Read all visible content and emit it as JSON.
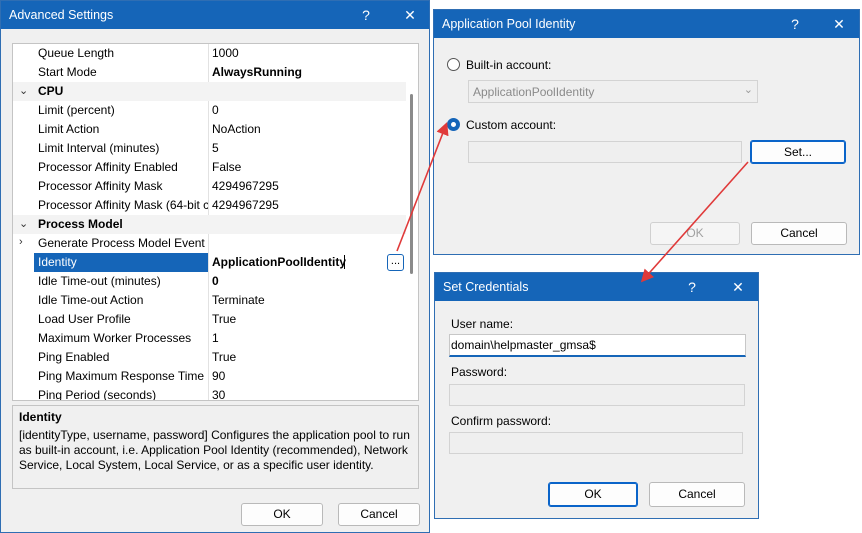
{
  "advanced": {
    "title": "Advanced Settings",
    "help": "?",
    "close": "✕",
    "rows": [
      {
        "name": "Queue Length",
        "value": "1000"
      },
      {
        "name": "Start Mode",
        "value": "AlwaysRunning",
        "bold": true
      },
      {
        "name": "CPU",
        "category": true,
        "chevron": "⌄"
      },
      {
        "name": "Limit (percent)",
        "value": "0"
      },
      {
        "name": "Limit Action",
        "value": "NoAction"
      },
      {
        "name": "Limit Interval (minutes)",
        "value": "5"
      },
      {
        "name": "Processor Affinity Enabled",
        "value": "False"
      },
      {
        "name": "Processor Affinity Mask",
        "value": "4294967295"
      },
      {
        "name": "Processor Affinity Mask (64-bit c",
        "value": "4294967295"
      },
      {
        "name": "Process Model",
        "category": true,
        "chevron": "⌄"
      },
      {
        "name": "Generate Process Model Event L",
        "value": "",
        "chevron": "›"
      },
      {
        "name": "Identity",
        "value": "ApplicationPoolIdentity",
        "selected": true
      },
      {
        "name": "Idle Time-out (minutes)",
        "value": "0",
        "bold": true
      },
      {
        "name": "Idle Time-out Action",
        "value": "Terminate"
      },
      {
        "name": "Load User Profile",
        "value": "True"
      },
      {
        "name": "Maximum Worker Processes",
        "value": "1"
      },
      {
        "name": "Ping Enabled",
        "value": "True"
      },
      {
        "name": "Ping Maximum Response Time (",
        "value": "90"
      },
      {
        "name": "Ping Period (seconds)",
        "value": "30"
      }
    ],
    "ellipsis": "...",
    "desc_title": "Identity",
    "desc_text": "[identityType, username, password] Configures the application pool to run as built-in account, i.e. Application Pool Identity (recommended), Network Service, Local System, Local Service, or as a specific user identity.",
    "ok": "OK",
    "cancel": "Cancel"
  },
  "pool": {
    "title": "Application Pool Identity",
    "help": "?",
    "close": "✕",
    "builtin_label": "Built-in account:",
    "builtin_value": "ApplicationPoolIdentity",
    "custom_label": "Custom account:",
    "custom_value": "",
    "set": "Set...",
    "ok": "OK",
    "cancel": "Cancel"
  },
  "creds": {
    "title": "Set Credentials",
    "help": "?",
    "close": "✕",
    "user_label": "User name:",
    "user_value": "domain\\helpmaster_gmsa$",
    "pass_label": "Password:",
    "confirm_label": "Confirm password:",
    "ok": "OK",
    "cancel": "Cancel"
  },
  "colors": {
    "accent": "#1565b8",
    "arrow": "#e03a3a"
  }
}
